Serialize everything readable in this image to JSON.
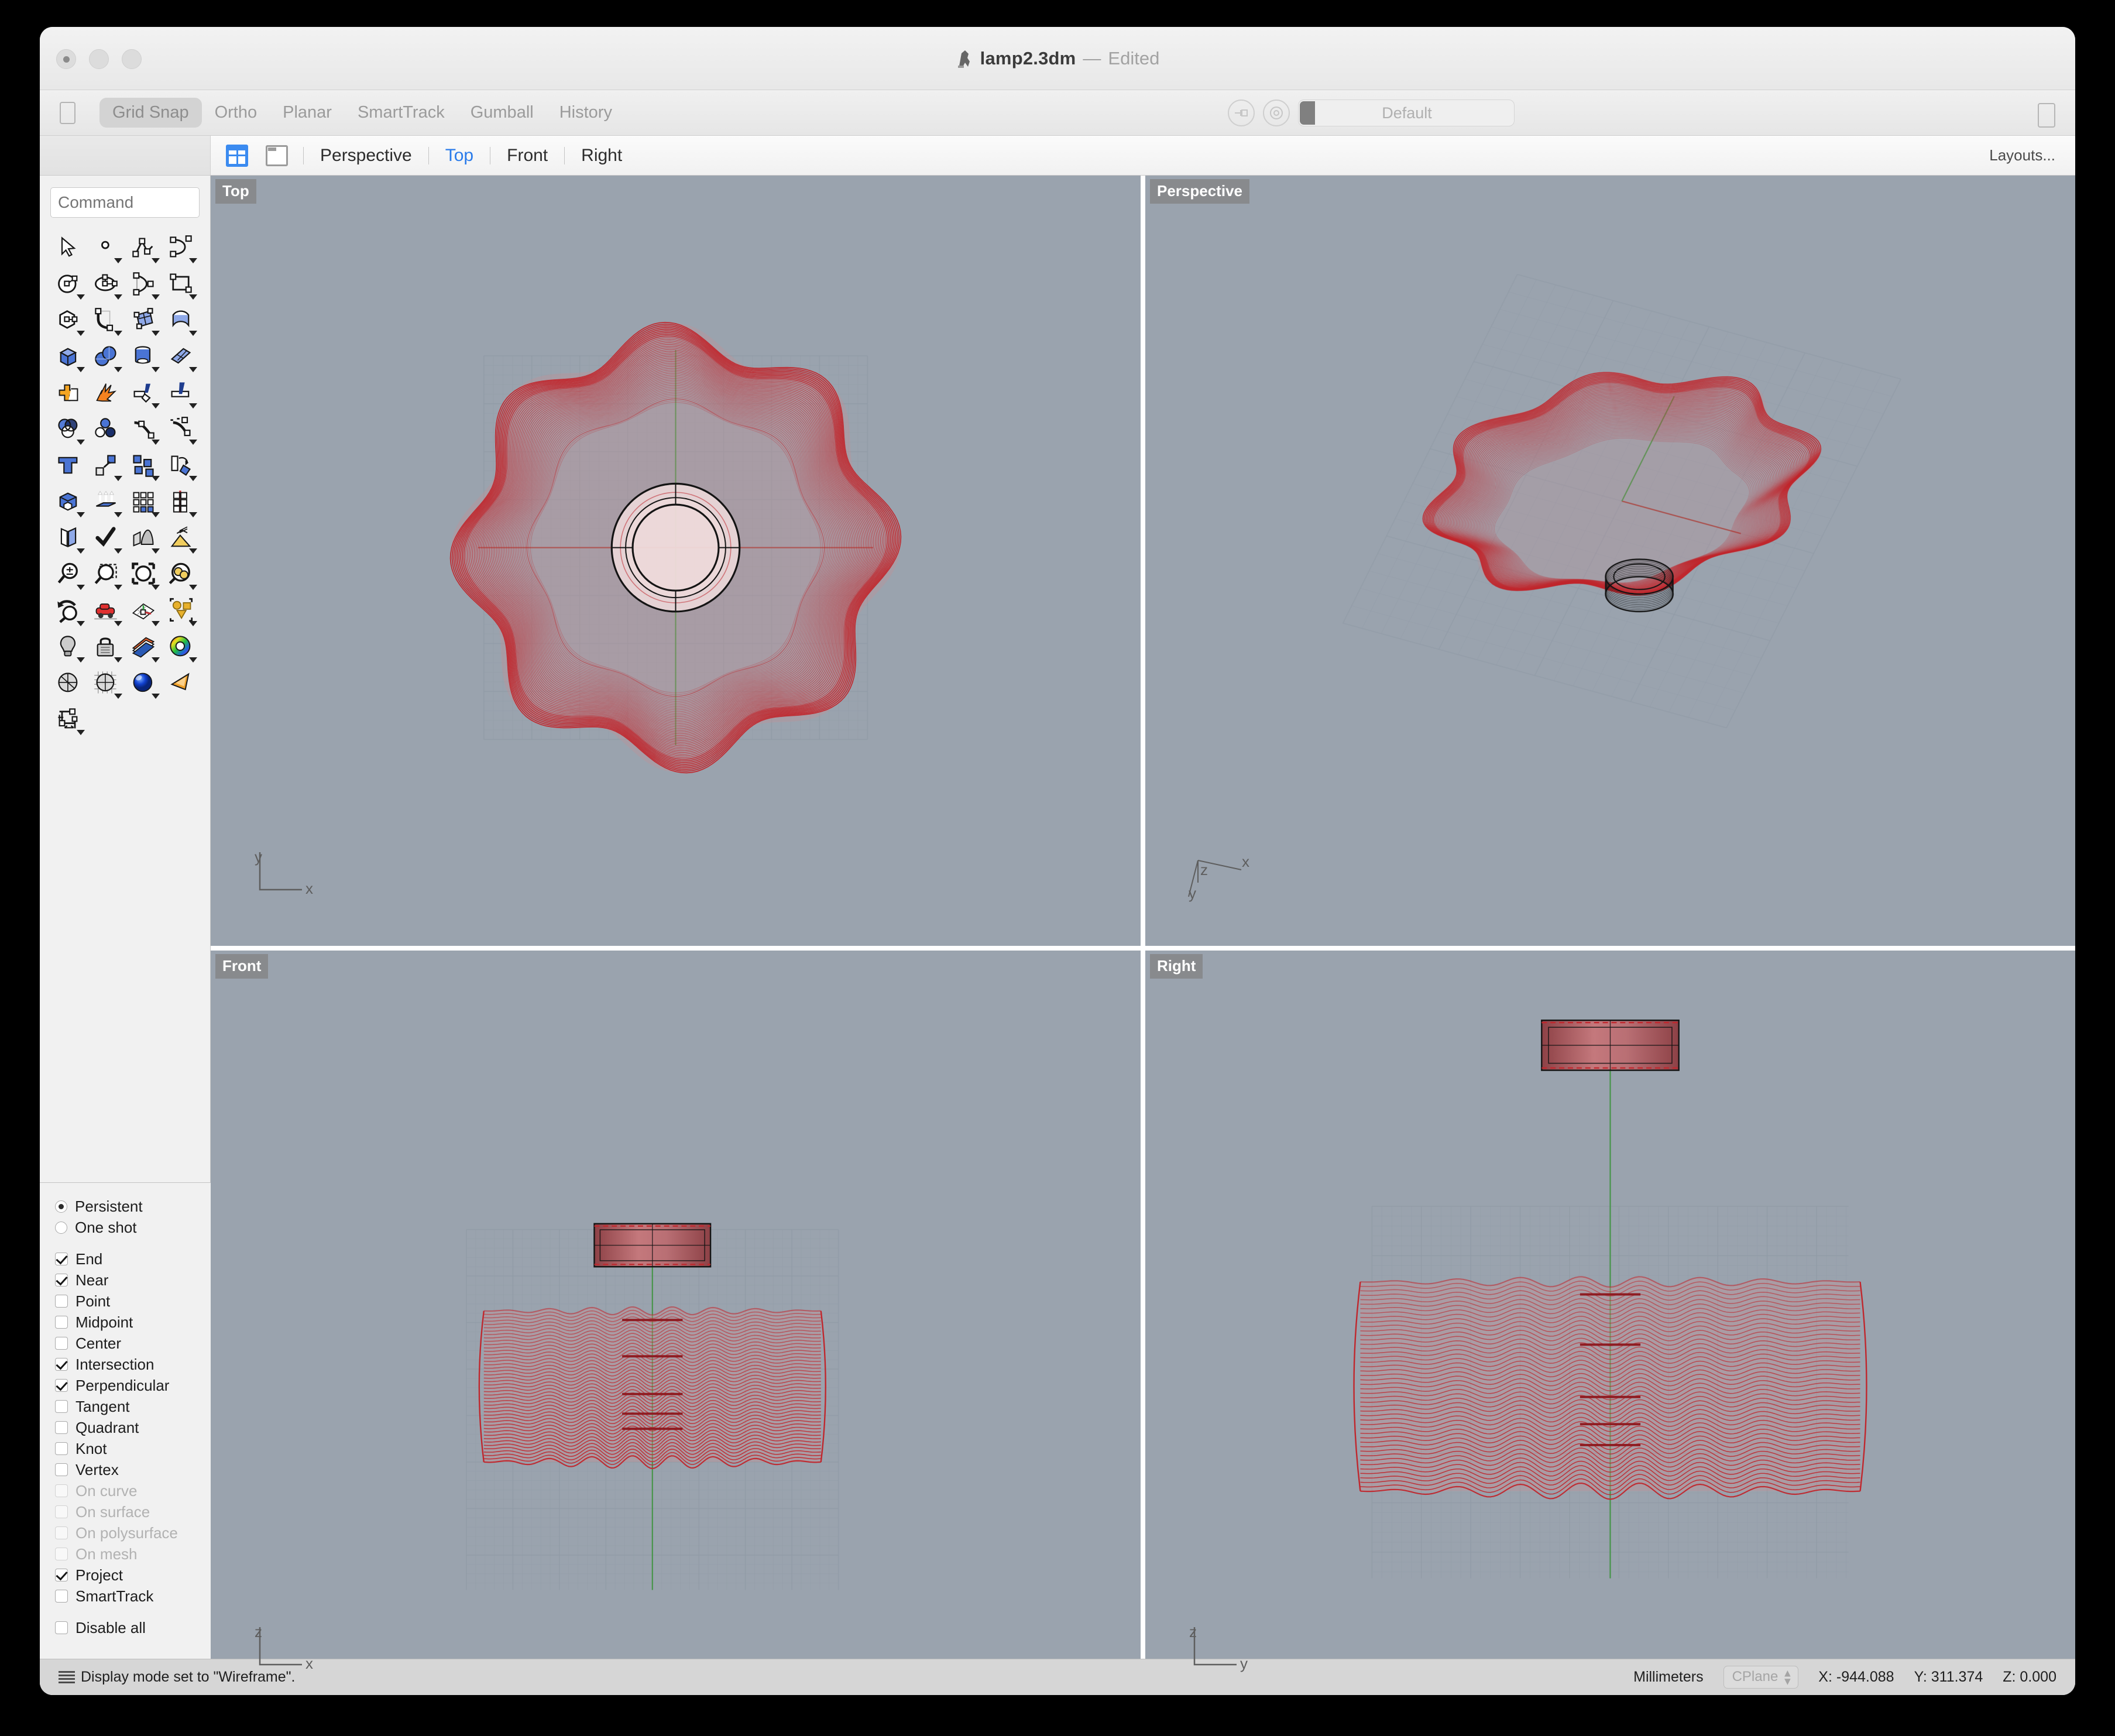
{
  "window": {
    "title": "lamp2.3dm",
    "title_separator": "—",
    "edited_label": "Edited",
    "app_icon": "rhino-icon"
  },
  "toolstrip": {
    "sidebar_toggle_icon": "sidebar-toggle-icon",
    "modes": [
      {
        "label": "Grid Snap",
        "active": true
      },
      {
        "label": "Ortho",
        "active": false
      },
      {
        "label": "Planar",
        "active": false
      },
      {
        "label": "SmartTrack",
        "active": false
      },
      {
        "label": "Gumball",
        "active": false
      },
      {
        "label": "History",
        "active": false
      }
    ],
    "layer": {
      "name": "Default",
      "swatch_color": "#808080",
      "link_icon": "link-icon",
      "target_icon": "target-icon"
    },
    "right_panel_toggle_icon": "right-panel-toggle-icon"
  },
  "viewport_tabs": {
    "layout_four_icon": "layout-four-pane-icon",
    "layout_one_icon": "layout-single-pane-icon",
    "tabs": [
      {
        "label": "Perspective",
        "active": false
      },
      {
        "label": "Top",
        "active": true
      },
      {
        "label": "Front",
        "active": false
      },
      {
        "label": "Right",
        "active": false
      }
    ],
    "layouts_label": "Layouts..."
  },
  "sidebar": {
    "command_placeholder": "Command",
    "command_value": "",
    "tools": [
      "select-arrow-icon",
      "point-icon",
      "polyline-icon",
      "curve-icon",
      "circle-icon",
      "ellipse-icon",
      "arc-icon",
      "rectangle-icon",
      "polygon-icon",
      "fillet-curve-icon",
      "surface-from-curves-icon",
      "extrude-surface-icon",
      "box-icon",
      "sphere-icon",
      "cylinder-icon",
      "surface-plane-icon",
      "boolean-union-icon",
      "explode-icon",
      "trim-icon",
      "split-icon",
      "offset-icon",
      "offset-curve-icon",
      "blend-curve-icon",
      "extend-curve-icon",
      "text-icon",
      "join-icon",
      "array-icon",
      "rotate-icon",
      "solid-tools-icon",
      "extrude-planar-icon",
      "array-grid-icon",
      "mirror-icon",
      "cap-icon",
      "check-icon",
      "mesh-icon",
      "smooth-icon",
      "zoom-in-out-icon",
      "zoom-window-icon",
      "zoom-extents-icon",
      "zoom-selected-icon",
      "zoom-previous-icon",
      "pan-icon",
      "set-cplane-icon",
      "named-views-icon",
      "light-icon",
      "lock-icon",
      "layers-icon",
      "color-wheel-icon",
      "shaded-view-icon",
      "ghosted-view-icon",
      "rendered-view-icon",
      "camera-icon",
      "dimension-icon"
    ]
  },
  "osnap": {
    "mode_options": [
      {
        "label": "Persistent",
        "selected": true
      },
      {
        "label": "One shot",
        "selected": false
      }
    ],
    "snaps": [
      {
        "label": "End",
        "checked": true,
        "enabled": true
      },
      {
        "label": "Near",
        "checked": true,
        "enabled": true
      },
      {
        "label": "Point",
        "checked": false,
        "enabled": true
      },
      {
        "label": "Midpoint",
        "checked": false,
        "enabled": true
      },
      {
        "label": "Center",
        "checked": false,
        "enabled": true
      },
      {
        "label": "Intersection",
        "checked": true,
        "enabled": true
      },
      {
        "label": "Perpendicular",
        "checked": true,
        "enabled": true
      },
      {
        "label": "Tangent",
        "checked": false,
        "enabled": true
      },
      {
        "label": "Quadrant",
        "checked": false,
        "enabled": true
      },
      {
        "label": "Knot",
        "checked": false,
        "enabled": true
      },
      {
        "label": "Vertex",
        "checked": false,
        "enabled": true
      },
      {
        "label": "On curve",
        "checked": false,
        "enabled": false
      },
      {
        "label": "On surface",
        "checked": false,
        "enabled": false
      },
      {
        "label": "On polysurface",
        "checked": false,
        "enabled": false
      },
      {
        "label": "On mesh",
        "checked": false,
        "enabled": false
      },
      {
        "label": "Project",
        "checked": true,
        "enabled": true
      },
      {
        "label": "SmartTrack",
        "checked": false,
        "enabled": true
      }
    ],
    "disable_all": {
      "label": "Disable all",
      "checked": false
    }
  },
  "viewports": [
    {
      "name": "Top",
      "label": "Top",
      "axes": [
        "y",
        "x"
      ]
    },
    {
      "name": "Perspective",
      "label": "Perspective",
      "axes": [
        "z",
        "x",
        "y"
      ]
    },
    {
      "name": "Front",
      "label": "Front",
      "axes": [
        "z",
        "x"
      ]
    },
    {
      "name": "Right",
      "label": "Right",
      "axes": [
        "z",
        "y"
      ]
    }
  ],
  "model": {
    "object_color": "#c0272d",
    "shade_fill": "#c98f92",
    "ring_fill": "#f0dcdc",
    "cplane_grid_color": "#8a95a1",
    "viewport_background": "#9aa3ae",
    "x_axis_color": "#a33a33",
    "y_axis_color": "#3f9440",
    "shade_lobes": 8,
    "isocurve_count": 48
  },
  "statusbar": {
    "menu_icon": "hamburger-icon",
    "message": "Display mode set to \"Wireframe\".",
    "units": "Millimeters",
    "cplane_label": "CPlane",
    "coords": {
      "x": "X: -944.088",
      "y": "Y: 311.374",
      "z": "Z: 0.000"
    }
  }
}
